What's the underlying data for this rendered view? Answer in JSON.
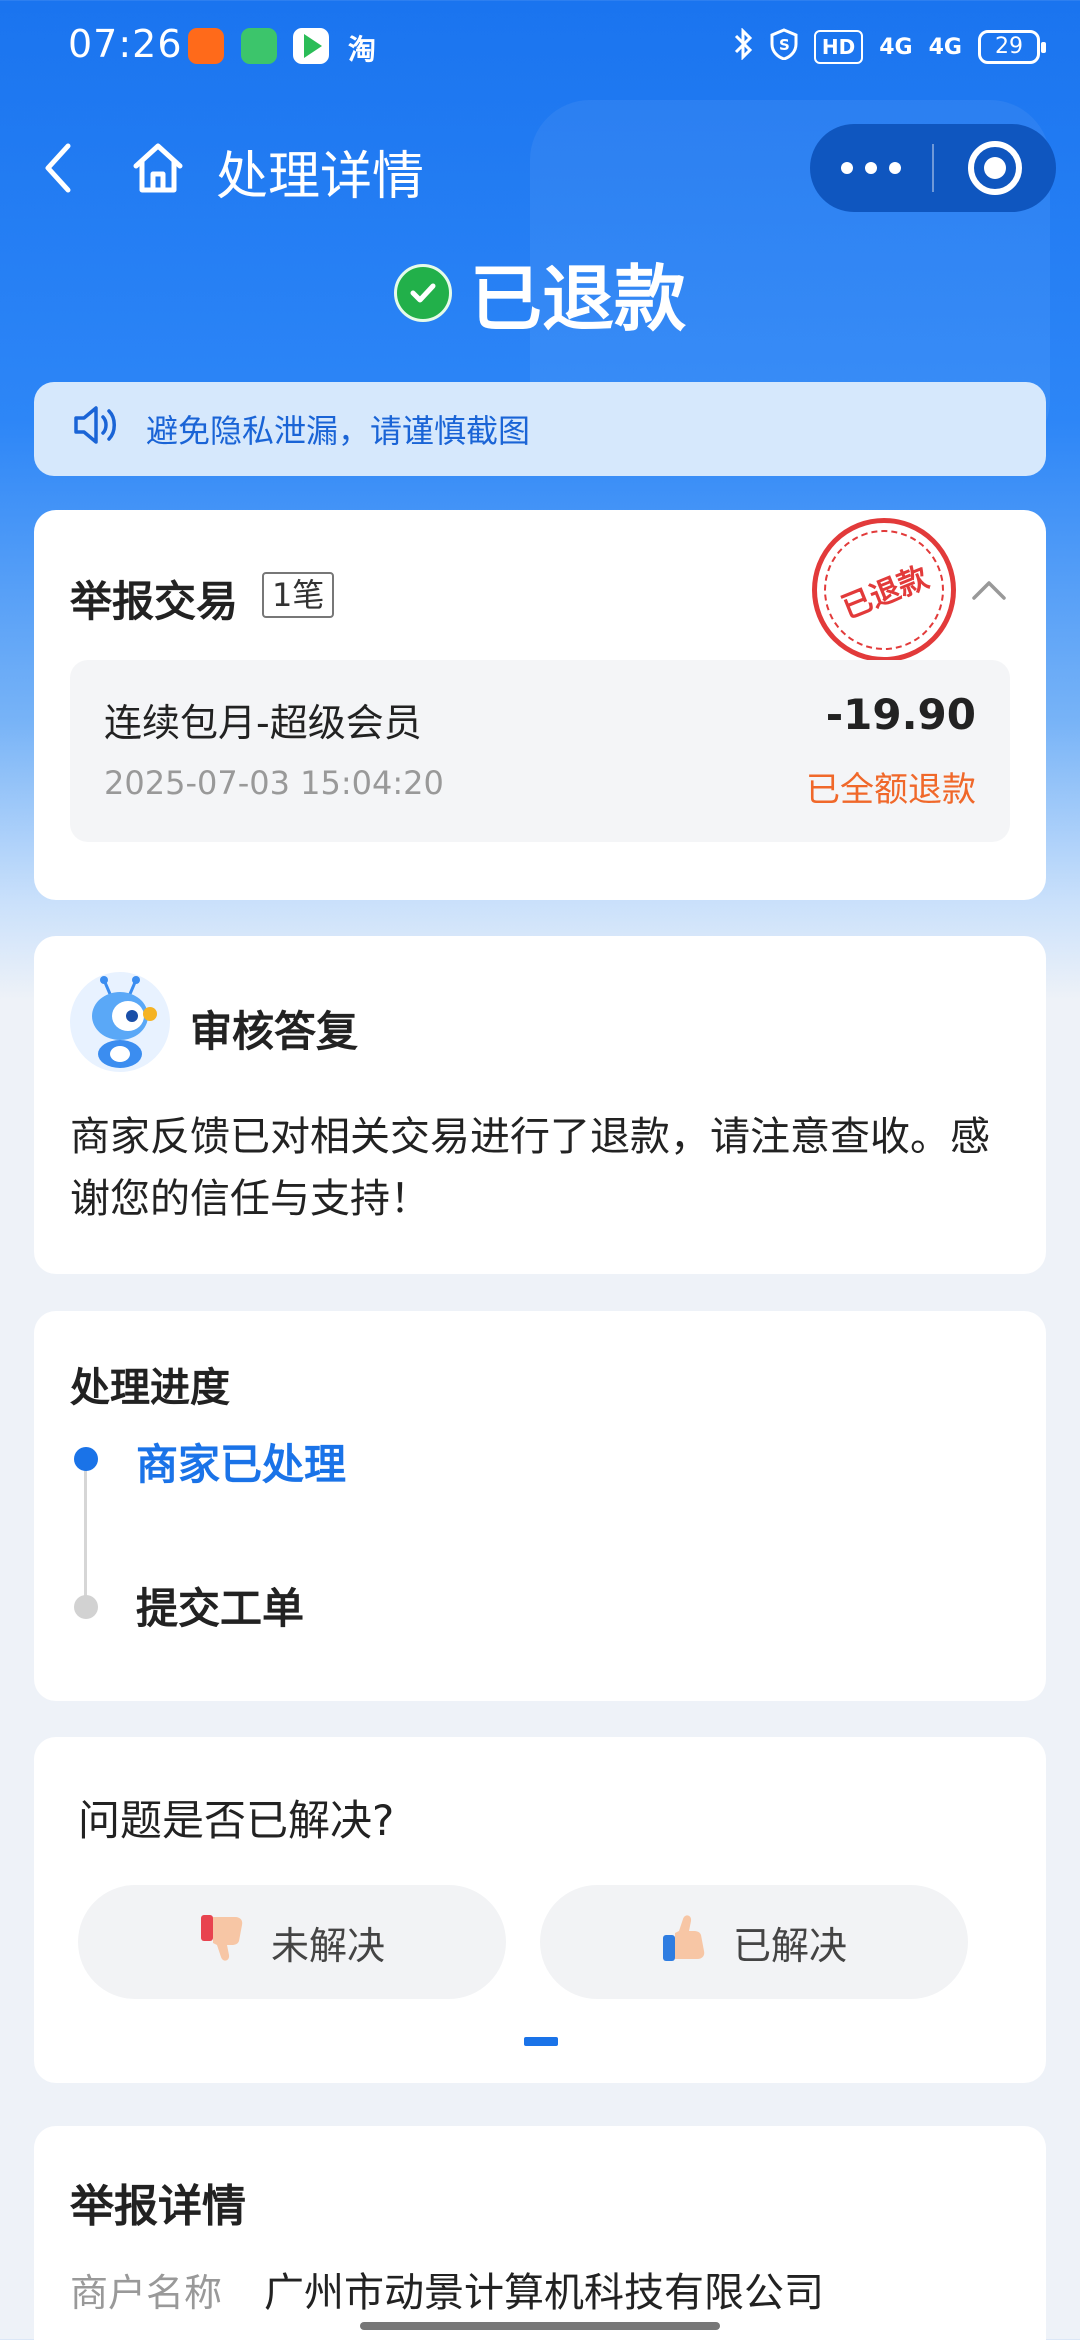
{
  "status_bar": {
    "time": "07:26",
    "app_icons": [
      "kuaishou-icon",
      "messages-icon",
      "video-icon"
    ],
    "taobao": "淘",
    "hd": "HD",
    "sig1": "4G",
    "sig2": "4G",
    "battery": "29"
  },
  "nav": {
    "title": "处理详情"
  },
  "header": {
    "status": "已退款"
  },
  "notice": {
    "text": "避免隐私泄漏，请谨慎截图"
  },
  "transaction": {
    "title": "举报交易",
    "count": "1笔",
    "stamp": "已退款",
    "item_name": "连续包月-超级会员",
    "amount": "-19.90",
    "time": "2025-07-03 15:04:20",
    "status": "已全额退款"
  },
  "reply": {
    "title": "审核答复",
    "body": "商家反馈已对相关交易进行了退款，请注意查收。感谢您的信任与支持！"
  },
  "progress": {
    "title": "处理进度",
    "steps": [
      "商家已处理",
      "提交工单"
    ]
  },
  "feedback": {
    "question": "问题是否已解决?",
    "unsolved": "未解决",
    "solved": "已解决"
  },
  "detail": {
    "title": "举报详情",
    "merchant_label": "商户名称",
    "merchant_value": "广州市动景计算机科技有限公司"
  },
  "colors": {
    "brand_blue": "#1a73e8",
    "success_green": "#22b04a",
    "refund_orange": "#f0682a",
    "stamp_red": "#e23a3a"
  }
}
